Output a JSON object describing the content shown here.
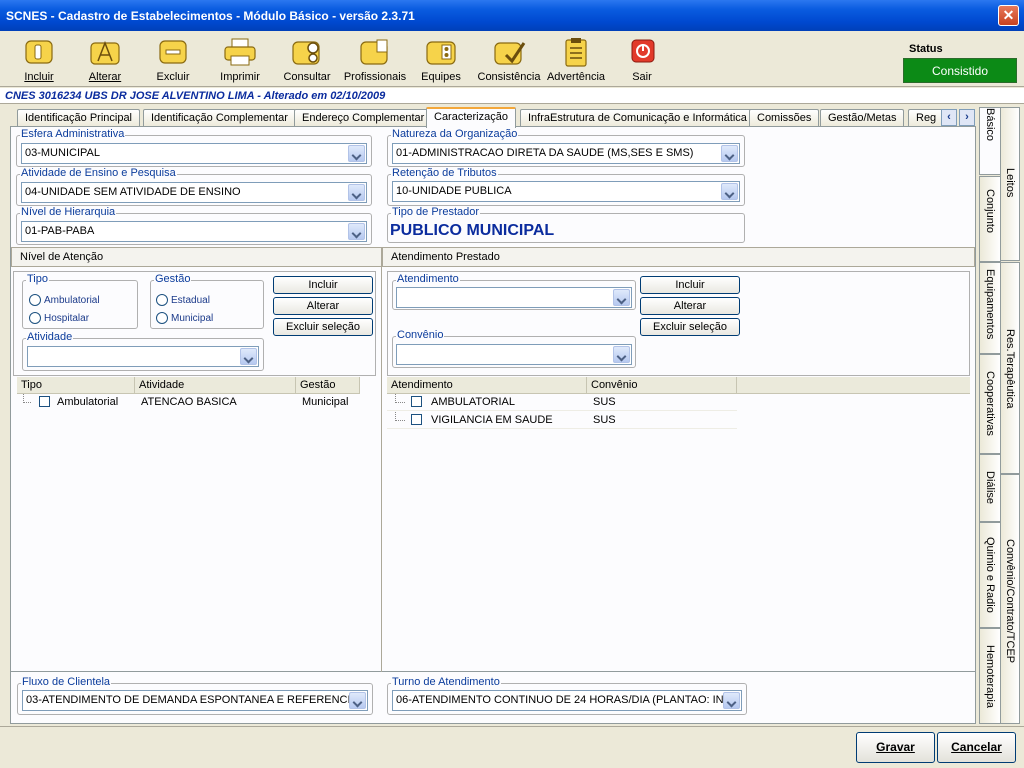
{
  "window": {
    "title": "SCNES - Cadastro de Estabelecimentos - Módulo Básico - versão 2.3.71",
    "close_label": "✕"
  },
  "toolbar": {
    "incluir": "Incluir",
    "alterar": "Alterar",
    "excluir": "Excluir",
    "imprimir": "Imprimir",
    "consultar": "Consultar",
    "profissionais": "Profissionais",
    "equipes": "Equipes",
    "consistencia": "Consistência",
    "advertencia": "Advertência",
    "sair": "Sair"
  },
  "status": {
    "caption": "Status",
    "value": "Consistido",
    "color": "#0c8a16"
  },
  "info_line": "CNES 3016234  UBS DR JOSE ALVENTINO LIMA - Alterado em 02/10/2009",
  "tabs": [
    "Identificação Principal",
    "Identificação Complementar",
    "Endereço Complementar",
    "Caracterização",
    "InfraEstrutura de Comunicação e Informática",
    "Comissões",
    "Gestão/Metas",
    "Reg"
  ],
  "active_tab": "Caracterização",
  "side_tabs": {
    "basico": "Básico",
    "leitos": "Leitos",
    "conjunto": "Conjunto",
    "equipamentos": "Equipamentos",
    "res_terapeutica": "Res.Terapêutica",
    "cooperativas": "Cooperativas",
    "dialise": "Diálise",
    "quimio": "Quimio e Radio",
    "convenio": "Convênio/Contrato/TCEP",
    "hemoterapia": "Hemoterapia"
  },
  "fields": {
    "esfera": {
      "label": "Esfera Administrativa",
      "value": "03-MUNICIPAL"
    },
    "natureza": {
      "label": "Natureza da Organização",
      "value": "01-ADMINISTRACAO DIRETA DA SAUDE (MS,SES E SMS)"
    },
    "atividade_ensino": {
      "label": "Atividade de Ensino e Pesquisa",
      "value": "04-UNIDADE SEM ATIVIDADE DE ENSINO"
    },
    "retencao": {
      "label": "Retenção de Tributos",
      "value": "10-UNIDADE PUBLICA"
    },
    "nivel_hierarquia": {
      "label": "Nível de Hierarquia",
      "value": "01-PAB-PABA"
    },
    "tipo_prestador": {
      "label": "Tipo de Prestador",
      "value": "PUBLICO MUNICIPAL"
    },
    "fluxo": {
      "label": "Fluxo de Clientela",
      "value": "03-ATENDIMENTO DE DEMANDA ESPONTANEA E REFERENCIA"
    },
    "turno": {
      "label": "Turno de Atendimento",
      "value": "06-ATENDIMENTO CONTINUO DE 24 HORAS/DIA (PLANTAO: IN"
    }
  },
  "nivel_atencao": {
    "title": "Nível de Atenção",
    "tipo_label": "Tipo",
    "tipo_options": [
      "Ambulatorial",
      "Hospitalar"
    ],
    "gestao_label": "Gestão",
    "gestao_options": [
      "Estadual",
      "Municipal"
    ],
    "atividade_label": "Atividade",
    "atividade_value": "",
    "buttons": {
      "incluir": "Incluir",
      "alterar": "Alterar",
      "excluir": "Excluir seleção"
    },
    "columns": [
      "Tipo",
      "Atividade",
      "Gestão"
    ],
    "rows": [
      {
        "tipo": "Ambulatorial",
        "atividade": "ATENCAO BASICA",
        "gestao": "Municipal"
      }
    ]
  },
  "atendimento_prestado": {
    "title": "Atendimento Prestado",
    "atendimento_label": "Atendimento",
    "atendimento_value": "",
    "convenio_label": "Convênio",
    "convenio_value": "",
    "buttons": {
      "incluir": "Incluir",
      "alterar": "Alterar",
      "excluir": "Excluir seleção"
    },
    "columns": [
      "Atendimento",
      "Convênio"
    ],
    "rows": [
      {
        "atendimento": "AMBULATORIAL",
        "convenio": "SUS"
      },
      {
        "atendimento": "VIGILANCIA EM SAUDE",
        "convenio": "SUS"
      }
    ]
  },
  "footer": {
    "gravar": "Gravar",
    "cancelar": "Cancelar"
  }
}
